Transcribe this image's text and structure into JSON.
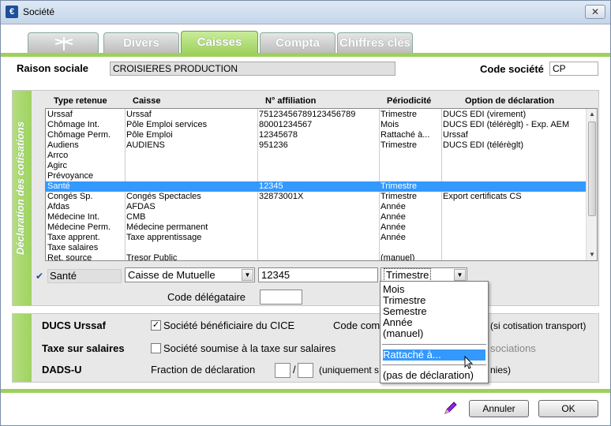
{
  "window": {
    "title": "Société",
    "close": "✕"
  },
  "tabs": [
    {
      "label": ""
    },
    {
      "label": "Divers"
    },
    {
      "label": "Caisses"
    },
    {
      "label": "Compta"
    },
    {
      "label": "Chiffres clés"
    }
  ],
  "header": {
    "raison_label": "Raison sociale",
    "raison_value": "CROISIERES PRODUCTION",
    "code_label": "Code société",
    "code_value": "CP"
  },
  "decl": {
    "vertical_title": "Déclaration des cotisations",
    "columns": [
      "Type retenue",
      "Caisse",
      "N° affiliation",
      "Périodicité",
      "Option de déclaration"
    ],
    "rows": [
      {
        "type": "Urssaf",
        "caisse": "Urssaf",
        "affil": "75123456789123456789",
        "period": "Trimestre",
        "option": "DUCS EDI (virement)"
      },
      {
        "type": "Chômage Int.",
        "caisse": "Pôle Emploi services",
        "affil": "80001234567",
        "period": "Mois",
        "option": "DUCS EDI (télérèglt) - Exp. AEM"
      },
      {
        "type": "Chômage Perm.",
        "caisse": "Pôle Emploi",
        "affil": "12345678",
        "period": "Rattaché à...",
        "option": "Urssaf"
      },
      {
        "type": "Audiens",
        "caisse": "AUDIENS",
        "affil": "951236",
        "period": "Trimestre",
        "option": "DUCS EDI (télérèglt)"
      },
      {
        "type": "Arrco",
        "caisse": "",
        "affil": "",
        "period": "",
        "option": ""
      },
      {
        "type": "Agirc",
        "caisse": "",
        "affil": "",
        "period": "",
        "option": ""
      },
      {
        "type": "Prévoyance",
        "caisse": "",
        "affil": "",
        "period": "",
        "option": ""
      },
      {
        "type": "Santé",
        "caisse": "",
        "affil": "12345",
        "period": "Trimestre",
        "option": ""
      },
      {
        "type": "Congés Sp.",
        "caisse": "Congés Spectacles",
        "affil": "32873001X",
        "period": "Trimestre",
        "option": "Export certificats CS"
      },
      {
        "type": "Afdas",
        "caisse": "AFDAS",
        "affil": "",
        "period": "Année",
        "option": ""
      },
      {
        "type": "Médecine Int.",
        "caisse": "CMB",
        "affil": "",
        "period": "Année",
        "option": ""
      },
      {
        "type": "Médecine Perm.",
        "caisse": "Médecine permanent",
        "affil": "",
        "period": "Année",
        "option": ""
      },
      {
        "type": "Taxe apprent.",
        "caisse": "Taxe apprentissage",
        "affil": "",
        "period": "Année",
        "option": ""
      },
      {
        "type": "Taxe salaires",
        "caisse": "",
        "affil": "",
        "period": "",
        "option": ""
      },
      {
        "type": "Ret. source",
        "caisse": "Tresor Public",
        "affil": "",
        "period": "(manuel)",
        "option": ""
      }
    ],
    "selected_index": 7,
    "edit": {
      "check": "✔",
      "type": "Santé",
      "caisse": "Caisse de Mutuelle",
      "affil": "12345",
      "period": "Trimestre",
      "delegataire_label": "Code délégataire",
      "delegataire_value": ""
    },
    "dropdown": {
      "group1": [
        "Mois",
        "Trimestre",
        "Semestre",
        "Année",
        "(manuel)"
      ],
      "highlighted": "Rattaché à...",
      "last": "(pas de déclaration)"
    }
  },
  "other": {
    "ducs_label": "DUCS Urssaf",
    "cice_label": "Société bénéficiaire du CICE",
    "cice_checked": "✓",
    "code_com_label": "Code com",
    "transport_note": "(si cotisation transport)",
    "taxe_label": "Taxe sur salaires",
    "taxe_check_label": "Société soumise à la taxe sur salaires",
    "associations_label": "sociations",
    "dads_label": "DADS-U",
    "fraction_label": "Fraction de déclaration",
    "fraction_a": "",
    "fraction_b": "",
    "fraction_sep": "/",
    "uniquement_label": "(uniquement s",
    "nies_label": "nies)"
  },
  "footer": {
    "cancel": "Annuler",
    "ok": "OK"
  },
  "colors": {
    "accent_green": "#9ed05e",
    "selection": "#3399ff"
  }
}
